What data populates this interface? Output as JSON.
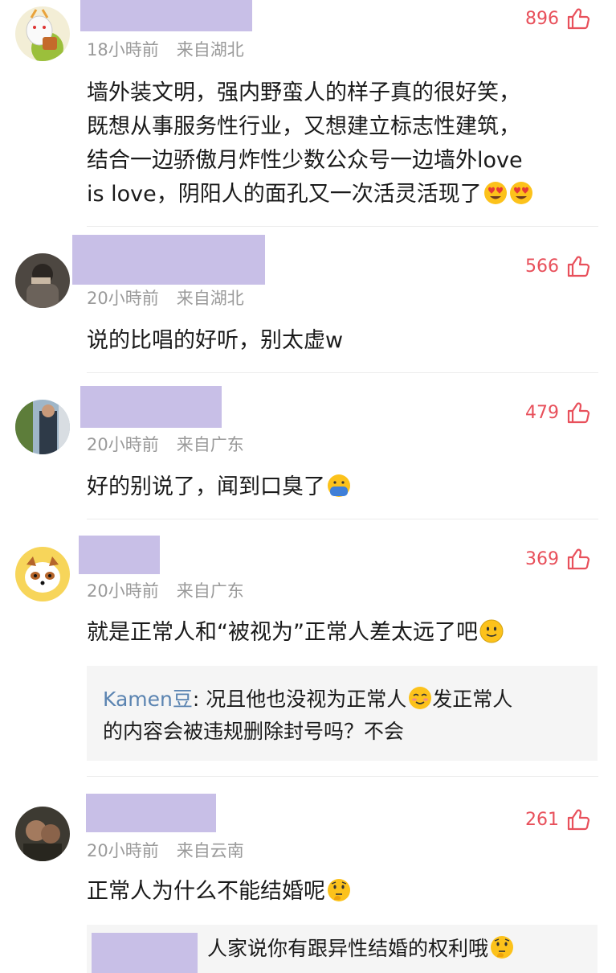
{
  "comments": [
    {
      "time": "18小時前",
      "location": "来自湖北",
      "likes": "896",
      "lines": [
        "墙外装文明，强内野蛮人的样子真的很好笑，",
        "既想从事服务性行业，又想建立标志性建筑，",
        "结合一边骄傲月炸性少数公众号一边墙外love",
        "is love，阴阳人的面孔又一次活灵活现了"
      ],
      "emoji": [
        "smiling-face-heart-eyes",
        "smiling-face-heart-eyes"
      ]
    },
    {
      "time": "20小時前",
      "location": "来自湖北",
      "likes": "566",
      "text": "说的比唱的好听，别太虚w"
    },
    {
      "time": "20小時前",
      "location": "来自广东",
      "likes": "479",
      "text": "好的别说了，闻到口臭了",
      "emoji": [
        "nauseated-face"
      ]
    },
    {
      "time": "20小時前",
      "location": "来自广东",
      "likes": "369",
      "text": "就是正常人和“被视为”正常人差太远了吧",
      "emoji": [
        "slightly-smiling-face"
      ],
      "reply": {
        "name": "Kamen豆",
        "text_a": ": 况且他也没视为正常人",
        "text_b": "发正常人",
        "line2": "的内容会被违规删除封号吗？不会"
      }
    },
    {
      "time": "20小時前",
      "location": "来自云南",
      "likes": "261",
      "text": "正常人为什么不能结婚呢",
      "emoji": [
        "thinking-face"
      ],
      "reply": {
        "text": "人家说你有跟异性结婚的权利哦"
      }
    }
  ],
  "colors": {
    "like": "#e8505b",
    "redaction": "#c8bfe7",
    "reply_name": "#5b84b1",
    "meta": "#9a9a9a"
  }
}
